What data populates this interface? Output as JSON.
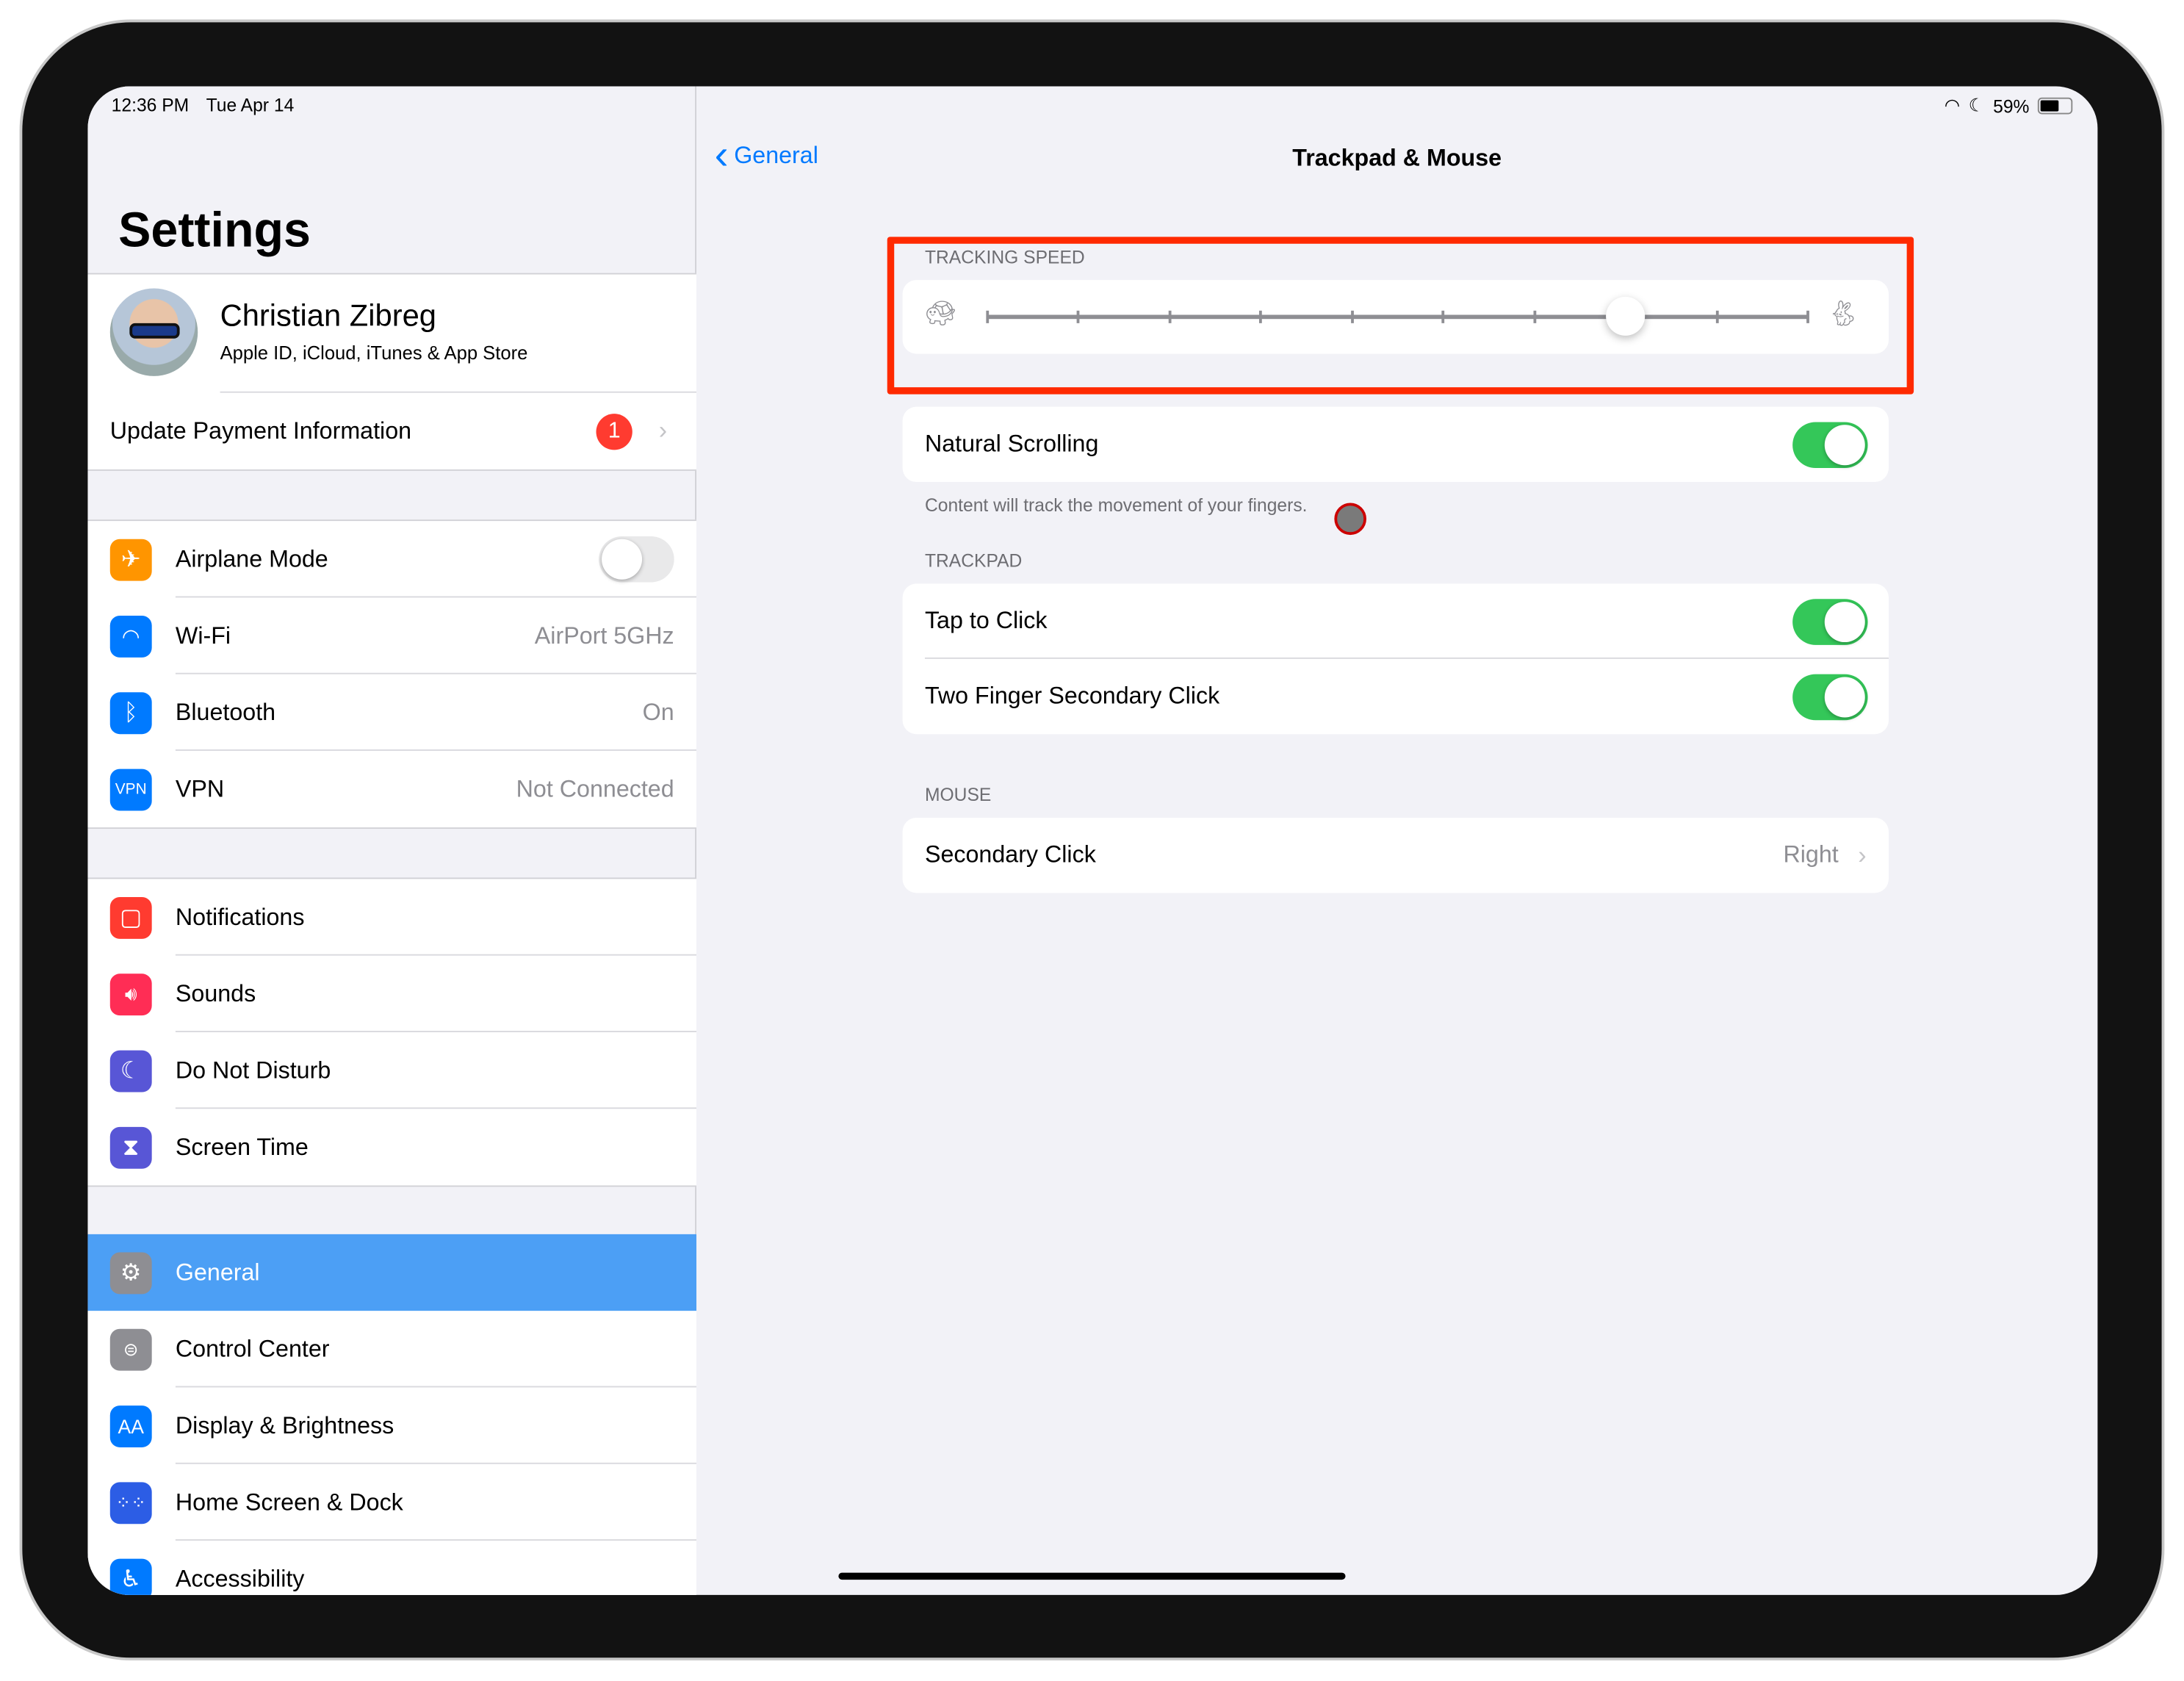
{
  "status_bar": {
    "time": "12:36 PM",
    "date": "Tue Apr 14",
    "battery": "59%",
    "icons": [
      "wifi-icon",
      "moon-icon",
      "battery-icon"
    ]
  },
  "sidebar": {
    "title": "Settings",
    "profile": {
      "name": "Christian Zibreg",
      "subtitle": "Apple ID, iCloud, iTunes & App Store"
    },
    "payment": {
      "label": "Update Payment Information",
      "badge": "1"
    },
    "group1": [
      {
        "label": "Airplane Mode",
        "icon": "airplane-icon",
        "color": "#ff9500",
        "toggle": false
      },
      {
        "label": "Wi-Fi",
        "icon": "wifi-icon",
        "color": "#007aff",
        "value": "AirPort 5GHz"
      },
      {
        "label": "Bluetooth",
        "icon": "bluetooth-icon",
        "color": "#007aff",
        "value": "On"
      },
      {
        "label": "VPN",
        "icon": "vpn-icon",
        "icon_text": "VPN",
        "color": "#007aff",
        "value": "Not Connected"
      }
    ],
    "group2": [
      {
        "label": "Notifications",
        "icon": "notifications-icon",
        "color": "#ff3b30"
      },
      {
        "label": "Sounds",
        "icon": "speaker-icon",
        "color": "#ff2d55"
      },
      {
        "label": "Do Not Disturb",
        "icon": "moon-icon",
        "color": "#5856d6"
      },
      {
        "label": "Screen Time",
        "icon": "hourglass-icon",
        "color": "#5856d6"
      }
    ],
    "group3": [
      {
        "label": "General",
        "icon": "gear-icon",
        "color": "#8e8e93",
        "selected": true
      },
      {
        "label": "Control Center",
        "icon": "switches-icon",
        "color": "#8e8e93"
      },
      {
        "label": "Display & Brightness",
        "icon": "text-size-icon",
        "icon_text": "AA",
        "color": "#007aff"
      },
      {
        "label": "Home Screen & Dock",
        "icon": "grid-icon",
        "color": "#2c5de5"
      },
      {
        "label": "Accessibility",
        "icon": "accessibility-icon",
        "color": "#007aff"
      }
    ]
  },
  "detail": {
    "back_label": "General",
    "title": "Trackpad & Mouse",
    "tracking_speed": {
      "header": "TRACKING SPEED",
      "value": 7,
      "min": 0,
      "max": 9,
      "highlight_color": "#ff2a00"
    },
    "natural_scrolling": {
      "label": "Natural Scrolling",
      "on": true,
      "footer": "Content will track the movement of your fingers."
    },
    "trackpad": {
      "header": "TRACKPAD",
      "rows": [
        {
          "label": "Tap to Click",
          "on": true
        },
        {
          "label": "Two Finger Secondary Click",
          "on": true
        }
      ]
    },
    "mouse": {
      "header": "MOUSE",
      "rows": [
        {
          "label": "Secondary Click",
          "value": "Right"
        }
      ]
    }
  },
  "colors": {
    "accent": "#007aff",
    "toggle_on": "#34c759",
    "selected_row": "#4c9ff5"
  }
}
